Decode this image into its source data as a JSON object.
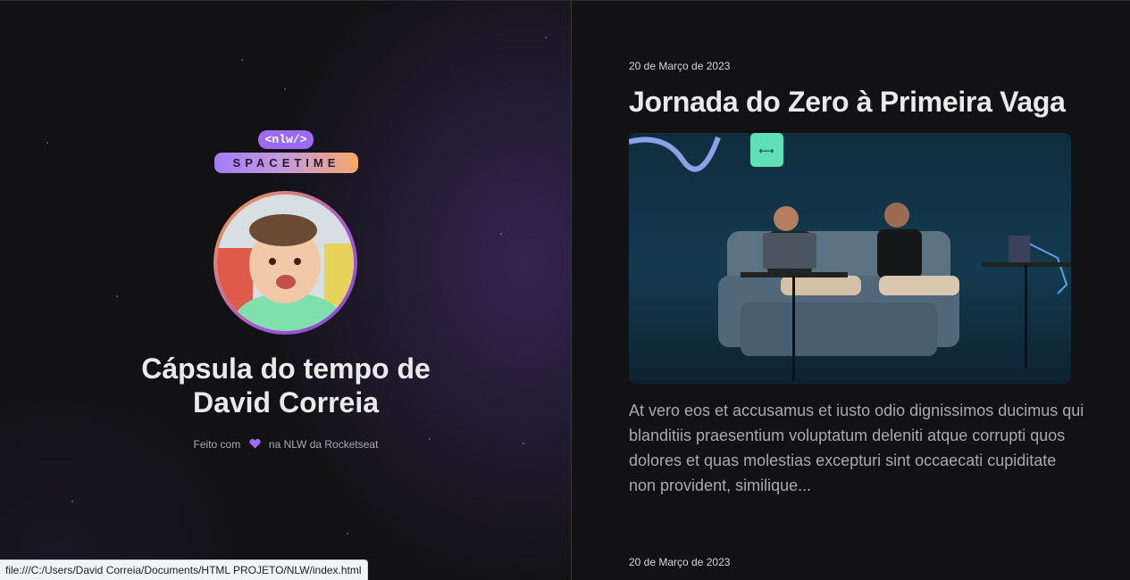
{
  "left": {
    "logo": {
      "top_text": "<nlw/>",
      "bottom_text": "SPACETIME"
    },
    "title_line1": "Cápsula do tempo de",
    "title_name": "David Correia",
    "made_prefix": "Feito com",
    "made_suffix": "na NLW da Rocketseat",
    "icons": {
      "heart": "heart-icon"
    }
  },
  "status_bar": {
    "url": "file:///C:/Users/David Correia/Documents/HTML PROJETO/NLW/index.html"
  },
  "memories": [
    {
      "date": "20 de Março de 2023",
      "title": "Jornada do Zero à Primeira Vaga",
      "excerpt": "At vero eos et accusamus et iusto odio dignissimos ducimus qui blanditiis praesentium voluptatum deleniti atque corrupti quos dolores et quas molestias excepturi sint occaecati cupiditate non provident, similique..."
    },
    {
      "date": "20 de Março de 2023"
    }
  ],
  "colors": {
    "background": "#121215",
    "purple": "#9b6bf5",
    "orange": "#f5a86a",
    "text_light": "#eaeaea",
    "text_muted": "#a9a9b2"
  }
}
